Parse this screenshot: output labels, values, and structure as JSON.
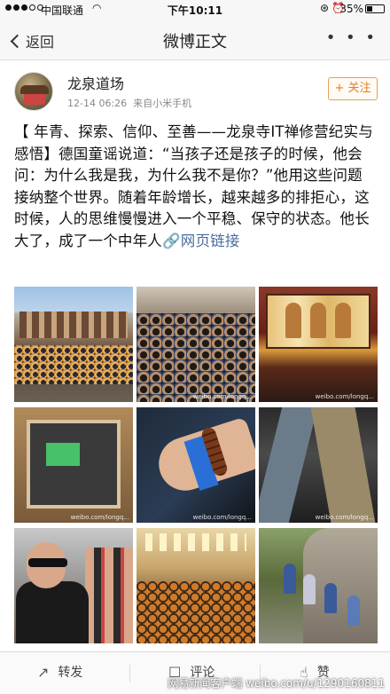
{
  "status_bar": {
    "carrier": "中国联通",
    "time": "下午10:11",
    "battery": "35%",
    "battery_level": 0.35
  },
  "nav": {
    "back_label": "返回",
    "title": "微博正文",
    "more_label": "• • •"
  },
  "post": {
    "username": "龙泉道场",
    "date": "12-14 06:26",
    "source": "来自小米手机",
    "follow_label": "+ 关注",
    "text_main": "【 年青、探索、信仰、至善——龙泉寺IT禅修营纪实与感悟】德国童谣说道：“当孩子还是孩子的时候，他会问：为什么我是我，为什么我不是你？”他用这些问题接纳整个世界。随着年龄增长，越来越多的排拒心，这时候，人的思维慢慢进入一个平稳、保守的状态。他长大了，成了一个中年人",
    "link_label": "网页链接",
    "photo_watermark": "weibo.com/longq..."
  },
  "actions": {
    "repost_label": "转发",
    "comment_label": "评论",
    "like_label": "赞"
  },
  "watermark": {
    "left_text": "网易新闻客户端",
    "right_text": "weibo.com/u/1290160811"
  },
  "icons": {
    "wifi": "wifi-icon",
    "lock": "orientation-lock-icon",
    "alarm": "alarm-icon",
    "link": "link-icon",
    "repost": "repost-icon",
    "comment": "comment-icon",
    "like": "like-icon"
  },
  "colors": {
    "accent": "#e07f1f",
    "link": "#4a6ea0"
  }
}
